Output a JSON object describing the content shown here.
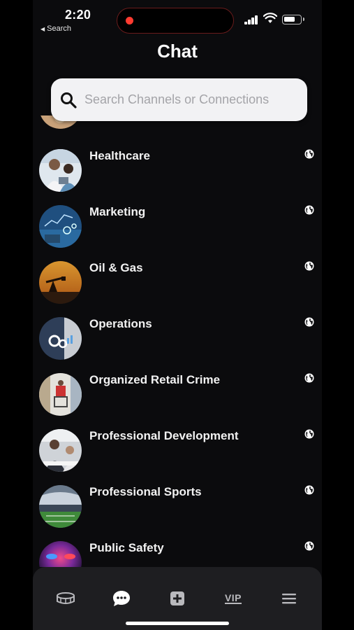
{
  "status_bar": {
    "time": "2:20",
    "back_app": "Search"
  },
  "header": {
    "title": "Chat"
  },
  "search": {
    "placeholder": "Search Channels or Connections"
  },
  "channels": [
    {
      "label": "Healthcare",
      "icon": "globe-icon"
    },
    {
      "label": "Marketing",
      "icon": "globe-icon"
    },
    {
      "label": "Oil & Gas",
      "icon": "globe-icon"
    },
    {
      "label": "Operations",
      "icon": "globe-icon"
    },
    {
      "label": "Organized Retail Crime",
      "icon": "globe-icon"
    },
    {
      "label": "Professional Development",
      "icon": "globe-icon"
    },
    {
      "label": "Professional Sports",
      "icon": "globe-icon"
    },
    {
      "label": "Public Safety",
      "icon": "globe-icon"
    }
  ],
  "tab_bar": {
    "tabs": [
      {
        "icon": "stadium-icon",
        "active": false
      },
      {
        "icon": "chat-icon",
        "active": true
      },
      {
        "icon": "add-icon",
        "active": false
      },
      {
        "icon": "vip-icon",
        "label": "VIP",
        "active": false
      },
      {
        "icon": "menu-icon",
        "active": false
      }
    ]
  },
  "colors": {
    "background": "#0b0b0d",
    "search_bg": "#f2f2f4",
    "tab_bar_bg": "#1e1e21",
    "icon_inactive": "#b9b9bd",
    "icon_active": "#ffffff"
  }
}
